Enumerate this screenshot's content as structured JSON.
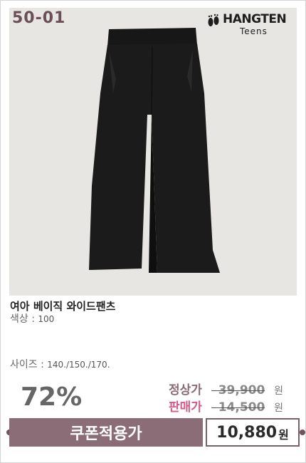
{
  "product": {
    "code": "50-01",
    "brand": {
      "name": "HANGTEN",
      "sub": "Teens",
      "logo_icon": "footprints-icon"
    },
    "name": "여아 베이직 와이드팬츠",
    "color_label": "색상 :",
    "color_value": "100",
    "size_label": "사이즈 :",
    "size_value": "140./150./170."
  },
  "pricing": {
    "discount": "72%",
    "regular_label": "정상가",
    "regular_price": "39,900",
    "sale_label": "판매가",
    "sale_price": "14,500",
    "currency": "원",
    "coupon_label": "쿠폰적용가",
    "final_price": "10,880",
    "final_currency": "원"
  },
  "colors": {
    "accent": "#8a6d76",
    "sale": "#d35b8a",
    "photo_bg": "#e7e6e2"
  }
}
